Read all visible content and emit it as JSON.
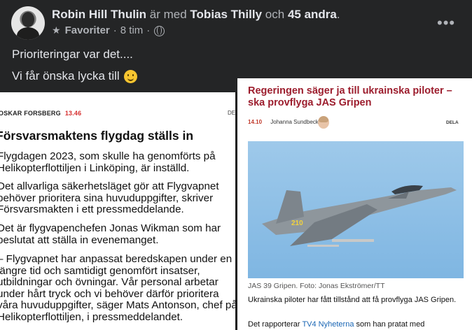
{
  "post": {
    "author": "Robin Hill Thulin",
    "with_text": "är med",
    "tagged": "Tobias Thilly",
    "and_text": "och",
    "others": "45 andra",
    "period": ".",
    "favorite_label": "Favoriter",
    "dot": "·",
    "time": "8 tim",
    "more_glyph": "•••",
    "text_line1": "Prioriteringar var det....",
    "text_line2": "Vi får önska lycka till"
  },
  "left_article": {
    "author": "OSKAR FORSBERG",
    "time": "13.46",
    "right_edge_label": "DE",
    "headline": "Försvarsmaktens flygdag ställs in",
    "paragraphs": [
      [
        "Flygdagen 2023, som skulle ha genomförts på",
        "Helikopterflottiljen i Linköping, är inställd."
      ],
      [
        "Det allvarliga säkerhetsläget gör att Flygvapnet",
        "behöver prioritera sina huvuduppgifter, skriver",
        "Försvarsmakten i ett pressmeddelande."
      ],
      [
        "Det är flygvapenchefen Jonas Wikman som har",
        "beslutat att ställa in evenemanget."
      ],
      [
        "– Flygvapnet har anpassat beredskapen under en",
        "längre tid och samtidigt genomfört insatser,",
        "utbildningar och övningar. Vår personal arbetar",
        "under hårt tryck och vi behöver därför prioritera",
        "våra huvuduppgifter, säger Mats Antonson, chef på",
        "Helikopterflottiljen, i pressmeddelandet."
      ]
    ]
  },
  "right_article": {
    "headline": "Regeringen säger ja till ukrainska piloter – ska provflyga JAS Gripen",
    "time": "14.10",
    "author": "Johanna Sundbeck",
    "share_label": "DELA",
    "image_marking": "210",
    "caption": "JAS 39 Gripen. Foto: Jonas Ekströmer/TT",
    "lead": "Ukrainska piloter har fått tillstånd att få provflyga JAS Gripen.",
    "body_prefix": "Det rapporterar",
    "body_link": "TV4 Nyheterna",
    "body_suffix": "som han pratat med"
  }
}
